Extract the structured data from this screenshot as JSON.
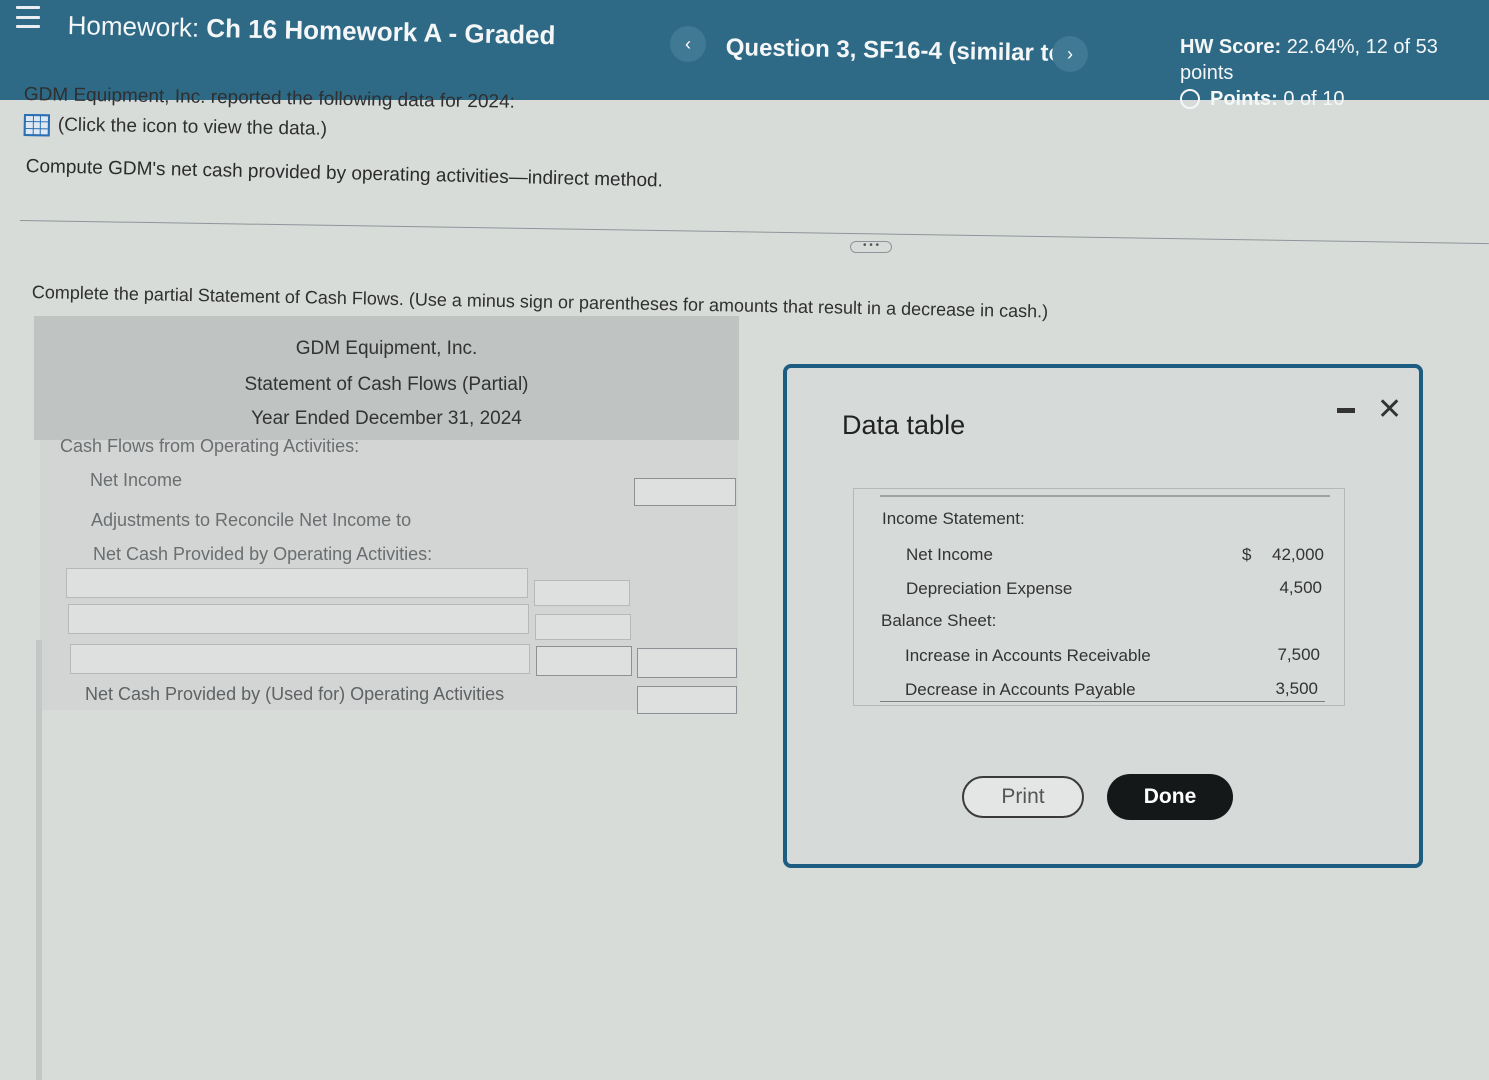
{
  "header": {
    "menu_icon": "hamburger-menu-icon",
    "hw_prefix": "Homework:",
    "hw_name": "Ch 16 Homework A - Graded",
    "prev_icon": "chevron-left-icon",
    "prev_glyph": "‹",
    "question_title": "Question 3, SF16-4 (similar to)",
    "next_icon": "chevron-right-icon",
    "next_glyph": "›",
    "score_label": "HW Score:",
    "score_value": "22.64%, 12 of 53 points",
    "points_label": "Points:",
    "points_value": "0 of 10"
  },
  "question": {
    "intro": "GDM Equipment, Inc. reported the following data for 2024:",
    "data_link": "(Click the icon to view the data.)",
    "task": "Compute GDM's net cash provided by operating activities—indirect method.",
    "expander": "• • •",
    "instruction": "Complete the partial Statement of Cash Flows. (Use a minus sign or parentheses for amounts that result in a decrease in cash.)"
  },
  "statement": {
    "company": "GDM Equipment, Inc.",
    "title": "Statement of Cash Flows (Partial)",
    "period": "Year Ended December 31, 2024",
    "section": "Cash Flows from Operating Activities:",
    "net_income_label": "Net Income",
    "adjust_line1": "Adjustments to Reconcile Net Income to",
    "adjust_line2": "Net Cash Provided by Operating Activities:",
    "total_label": "Net Cash Provided by (Used for) Operating Activities"
  },
  "modal": {
    "title": "Data table",
    "minimize_icon": "minimize-icon",
    "close_icon": "close-icon",
    "close_glyph": "✕",
    "income_statement": "Income Statement:",
    "net_income": "Net Income",
    "dollar": "$",
    "net_income_value": "42,000",
    "depreciation": "Depreciation Expense",
    "depreciation_value": "4,500",
    "balance_sheet": "Balance Sheet:",
    "ar": "Increase in Accounts Receivable",
    "ar_value": "7,500",
    "ap": "Decrease in Accounts Payable",
    "ap_value": "3,500",
    "print_label": "Print",
    "done_label": "Done"
  }
}
